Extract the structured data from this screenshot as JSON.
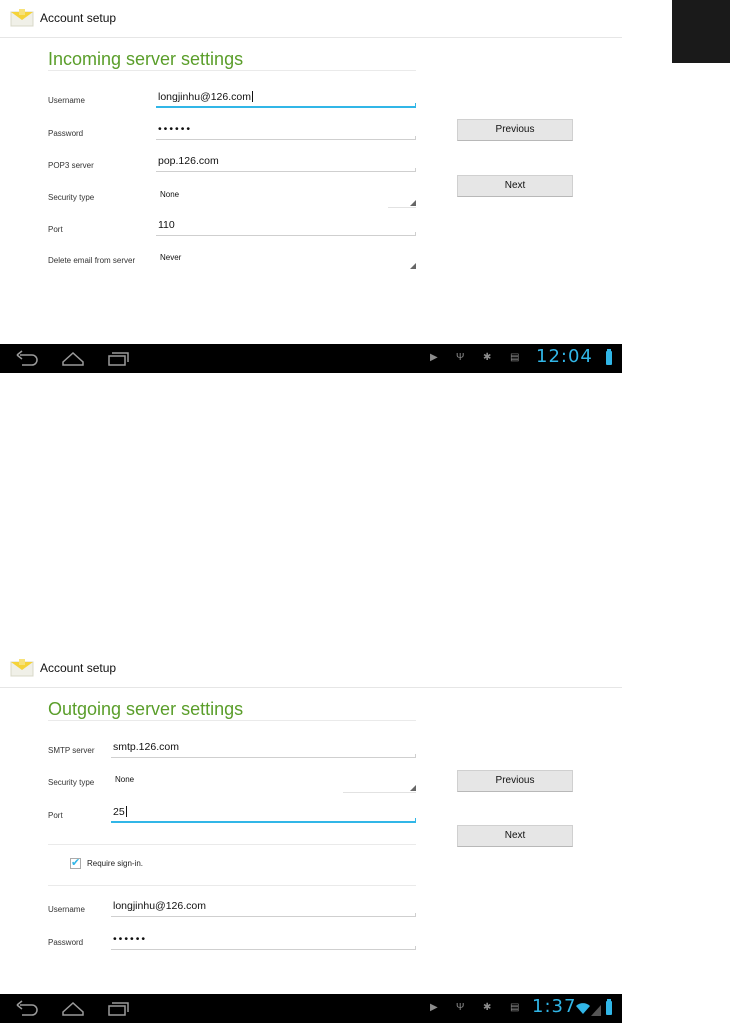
{
  "screen1": {
    "actionbar": {
      "title": "Account setup"
    },
    "heading": "Incoming server settings",
    "fields": {
      "username": {
        "label": "Username",
        "value": "longjinhu@126.com"
      },
      "password": {
        "label": "Password",
        "value": "••••••"
      },
      "pop3": {
        "label": "POP3 server",
        "value": "pop.126.com"
      },
      "security": {
        "label": "Security type",
        "value": "None"
      },
      "port": {
        "label": "Port",
        "value": "110"
      },
      "delete": {
        "label": "Delete email from server",
        "value": "Never"
      }
    },
    "buttons": {
      "previous": "Previous",
      "next": "Next"
    },
    "statusbar": {
      "clock": "12:04"
    }
  },
  "screen2": {
    "actionbar": {
      "title": "Account setup"
    },
    "heading": "Outgoing server settings",
    "fields": {
      "smtp": {
        "label": "SMTP server",
        "value": "smtp.126.com"
      },
      "security": {
        "label": "Security type",
        "value": "None"
      },
      "port": {
        "label": "Port",
        "value": "25"
      },
      "username": {
        "label": "Username",
        "value": "longjinhu@126.com"
      },
      "password": {
        "label": "Password",
        "value": "••••••"
      }
    },
    "require_signin": {
      "label": "Require sign-in.",
      "checked": true
    },
    "buttons": {
      "previous": "Previous",
      "next": "Next"
    },
    "statusbar": {
      "clock": "1:37"
    }
  },
  "colors": {
    "accent": "#31b6e7",
    "heading": "#5a9e2a",
    "navbar": "#000000",
    "button": "#e6e6e6"
  },
  "icons": {
    "app": "email-envelope-icon",
    "nav": [
      "back-icon",
      "home-icon",
      "recent-apps-icon"
    ],
    "status": [
      "play-icon",
      "usb-icon",
      "debug-icon",
      "sd-card-icon",
      "wifi-icon",
      "signal-icon",
      "battery-icon"
    ]
  }
}
